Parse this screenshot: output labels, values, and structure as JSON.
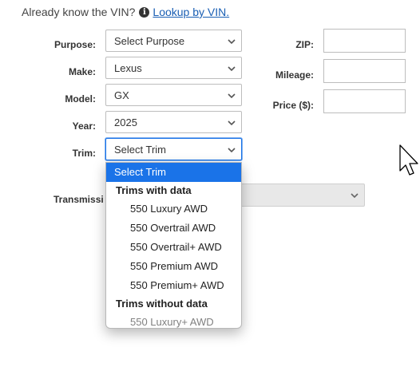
{
  "vin": {
    "prompt": "Already know the VIN?",
    "info_icon": "info-circle-icon",
    "link": "Lookup by VIN."
  },
  "form": {
    "purpose": {
      "label": "Purpose:",
      "value": "Select Purpose"
    },
    "make": {
      "label": "Make:",
      "value": "Lexus"
    },
    "model": {
      "label": "Model:",
      "value": "GX"
    },
    "year": {
      "label": "Year:",
      "value": "2025"
    },
    "trim": {
      "label": "Trim:",
      "value": "Select Trim"
    },
    "transmission": {
      "label": "Transmissi"
    },
    "zip": {
      "label": "ZIP:",
      "value": ""
    },
    "mileage": {
      "label": "Mileage:",
      "value": ""
    },
    "price": {
      "label": "Price ($):",
      "value": ""
    }
  },
  "trim_dropdown": {
    "selected": "Select Trim",
    "groups": [
      {
        "label": "Trims with data",
        "options": [
          "550 Luxury AWD",
          "550 Overtrail AWD",
          "550 Overtrail+ AWD",
          "550 Premium AWD",
          "550 Premium+ AWD"
        ]
      },
      {
        "label": "Trims without data",
        "options": [
          "550 Luxury+ AWD"
        ]
      }
    ]
  },
  "icons": {
    "chevron": "chevron-down-icon",
    "cursor": "mouse-pointer-icon"
  },
  "colors": {
    "link": "#1a5fb4",
    "selected_option": "#1a73e8"
  }
}
